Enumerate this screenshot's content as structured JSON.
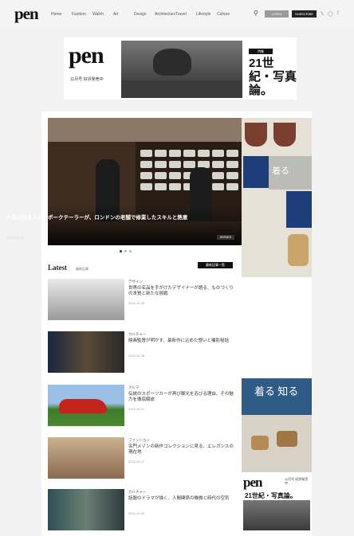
{
  "header": {
    "logo": "pen",
    "nav": [
      "Home",
      "Fashion",
      "Watch",
      "Art",
      "Design",
      "Architecture",
      "Travel",
      "Lifestyle",
      "Culture"
    ],
    "login_label": "LOGIN",
    "subscribe_label": "SUBSCRIBE",
    "social": [
      "x-icon",
      "instagram-icon",
      "facebook-icon"
    ]
  },
  "banner_ad": {
    "logo": "pen",
    "sub": "11月号 好評発売中",
    "tag": "特集",
    "title": "21世紀・写真論。"
  },
  "hero": {
    "title": "人気の日本人ビスポークテーラーが、ロンドンの老舗で修業したスキルと熱意",
    "date": "2024.10.28",
    "badge": "SERIES"
  },
  "side_ad": {
    "text": "着る"
  },
  "latest": {
    "heading": "Latest",
    "sub": "最新記事",
    "more_label": "最新記事一覧"
  },
  "articles": [
    {
      "category": "デザイン",
      "title": "世界の名品を手がけたデザイナーが語る、ものづくりの本質と新たな挑戦",
      "date": "2024.10.28"
    },
    {
      "category": "カルチャー",
      "title": "映画監督が明かす、最新作に込めた想いと撮影秘話",
      "date": "2024.10.28"
    },
    {
      "category": "クルマ",
      "title": "伝説のスポーツカーが再び脚光を浴びる理由、その魅力を徹底解説",
      "date": "2024.10.27"
    },
    {
      "category": "ファッション",
      "title": "名門メゾンの新作コレクションに見る、エレガンスの現在地",
      "date": "2024.10.27"
    },
    {
      "category": "カルチャー",
      "title": "話題のドラマが描く、人間関係の機微と時代の空気",
      "date": "2024.10.26"
    }
  ],
  "side_ad2": {
    "text": "着る 知る"
  },
  "side_ad3": {
    "logo": "pen",
    "tag": "11月号 好評発売中",
    "title": "21世紀・写真論。"
  }
}
